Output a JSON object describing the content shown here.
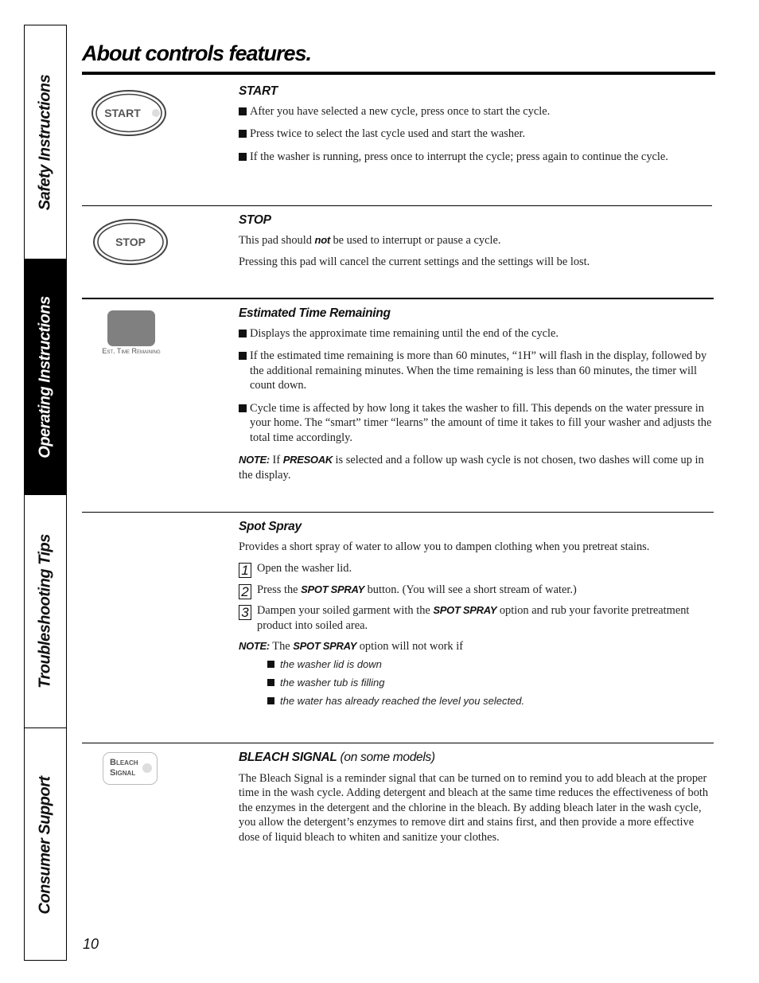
{
  "page": {
    "title": "About controls features.",
    "page_number": "10"
  },
  "sidebar": {
    "tabs": [
      {
        "label": "Safety Instructions",
        "active": false
      },
      {
        "label": "Operating Instructions",
        "active": true
      },
      {
        "label": "Troubleshooting Tips",
        "active": false
      },
      {
        "label": "Consumer Support",
        "active": false
      }
    ]
  },
  "icons": {
    "start_label": "START",
    "stop_label": "STOP",
    "est_label": "Est. Time Remaining",
    "bleach_line1": "Bleach",
    "bleach_line2": "Signal",
    "colors": {
      "display_gray": "#808080",
      "indicator_dot": "#dddddd"
    }
  },
  "sections": {
    "start": {
      "heading": "START",
      "bullets": [
        "After you have selected a new cycle, press once to start the cycle.",
        "Press twice to select the last cycle used and start the washer.",
        "If the washer is running, press once to interrupt the cycle; press again to continue the cycle."
      ]
    },
    "stop": {
      "heading": "STOP",
      "p1_before": "This pad should ",
      "p1_emph": "not",
      "p1_after": " be used to interrupt or pause a cycle.",
      "p2": "Pressing this pad will cancel the current settings and the settings will be lost."
    },
    "est_time": {
      "heading": "Estimated Time Remaining",
      "bullets": [
        "Displays the approximate time remaining until the end of the cycle.",
        "If the estimated time remaining is more than 60 minutes, “1H” will flash in the display, followed by the additional remaining minutes. When the time remaining is less than 60 minutes, the timer will count down.",
        "Cycle time is affected by how long it takes the washer to fill. This depends on the water pressure in your home. The “smart” timer “learns” the amount of time it takes to fill your washer and adjusts the total time accordingly."
      ],
      "note_label": "NOTE:",
      "note_if": " If ",
      "note_kw": "PRESOAK",
      "note_rest": " is selected and a follow up wash cycle is not chosen, two dashes will come up in the display."
    },
    "spot_spray": {
      "heading": "Spot Spray",
      "intro": "Provides a short spray of water to allow you to dampen clothing when you pretreat stains.",
      "steps": [
        {
          "num": "1",
          "before": "Open the washer lid.",
          "kw": "",
          "after": ""
        },
        {
          "num": "2",
          "before": "Press the ",
          "kw": "SPOT SPRAY",
          "after": " button.  (You will see a short stream of water.)"
        },
        {
          "num": "3",
          "before": "Dampen your soiled garment with the ",
          "kw": "SPOT SPRAY",
          "after": " option and rub your favorite pretreatment product into soiled area."
        }
      ],
      "note_label": "NOTE:",
      "note_the": " The ",
      "note_kw": "SPOT SPRAY",
      "note_rest": " option will not work if",
      "conditions": [
        "the washer lid is down",
        "the washer tub is filling",
        "the water has already reached the level you selected."
      ]
    },
    "bleach": {
      "heading": "BLEACH SIGNAL",
      "heading_sub": " (on some models)",
      "body": "The Bleach Signal is a reminder signal that can be turned on to remind you to add bleach at the proper time in the wash cycle. Adding detergent and bleach at the same time reduces the effectiveness of both the enzymes in the detergent and the chlorine in the bleach. By adding bleach later in the wash cycle, you allow the detergent’s enzymes to remove dirt and stains first, and then provide a more effective dose of liquid bleach to whiten and sanitize your clothes."
    }
  }
}
